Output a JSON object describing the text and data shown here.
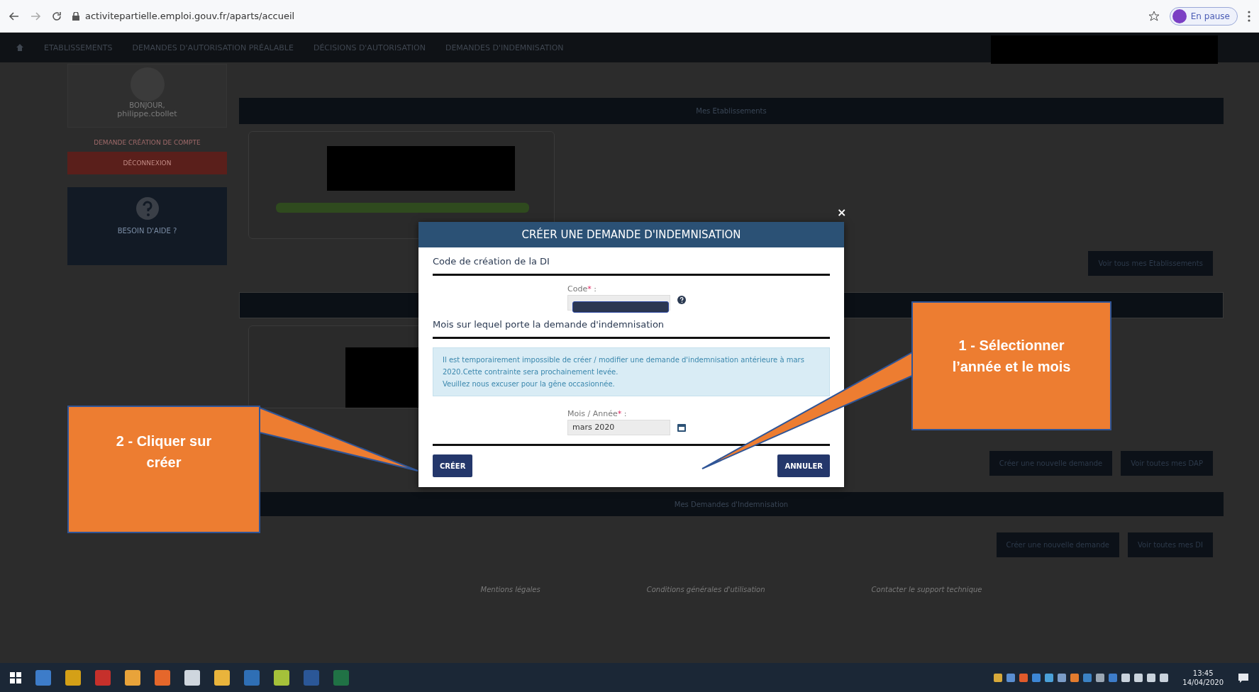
{
  "browser": {
    "url": "activitepartielle.emploi.gouv.fr/aparts/accueil",
    "profile_label": "En pause"
  },
  "nav": {
    "items": [
      "ETABLISSEMENTS",
      "DEMANDES D'AUTORISATION PRÉALABLE",
      "DÉCISIONS D'AUTORISATION",
      "DEMANDES D'INDEMNISATION"
    ]
  },
  "sidebar": {
    "greeting": "BONJOUR,",
    "user": "philippe.cbollet",
    "account_link": "DEMANDE CRÉATION DE COMPTE",
    "logout": "DÉCONNEXION",
    "help_title": "BESOIN D'AIDE ?"
  },
  "main": {
    "establishments_header": "Mes Etablissements",
    "see_all_establishments": "Voir tous mes Etablissements",
    "dap_buttons": [
      "Créer une nouvelle demande",
      "Voir toutes mes DAP"
    ],
    "di_header": "Mes Demandes d'Indemnisation",
    "di_buttons": [
      "Créer une nouvelle demande",
      "Voir toutes mes DI"
    ],
    "footer_links": [
      "Mentions légales",
      "Conditions générales d'utilisation",
      "Contacter le support technique"
    ]
  },
  "modal": {
    "title": "CRÉER UNE DEMANDE D'INDEMNISATION",
    "close": "×",
    "section_1": "Code de création de la DI",
    "code_field": {
      "label": "Code",
      "required_mark": "*",
      "separator": ":"
    },
    "section_2": "Mois sur lequel porte la demande d'indemnisation",
    "info": [
      "Il est temporairement impossible de créer / modifier une demande d'indemnisation antérieure à mars 2020.Cette contrainte sera prochainement levée.",
      "Veuillez nous excuser pour la gêne occasionnée."
    ],
    "month_field": {
      "label": "Mois / Année",
      "required_mark": "*",
      "separator": ":",
      "value": "mars 2020"
    },
    "buttons": [
      "CRÉER",
      "ANNULER"
    ]
  },
  "callouts": [
    {
      "text": "1 - Sélectionner l’année et le mois"
    },
    {
      "text": "2 - Cliquer sur créer"
    }
  ],
  "taskbar": {
    "time": "13:45",
    "date": "14/04/2020"
  }
}
